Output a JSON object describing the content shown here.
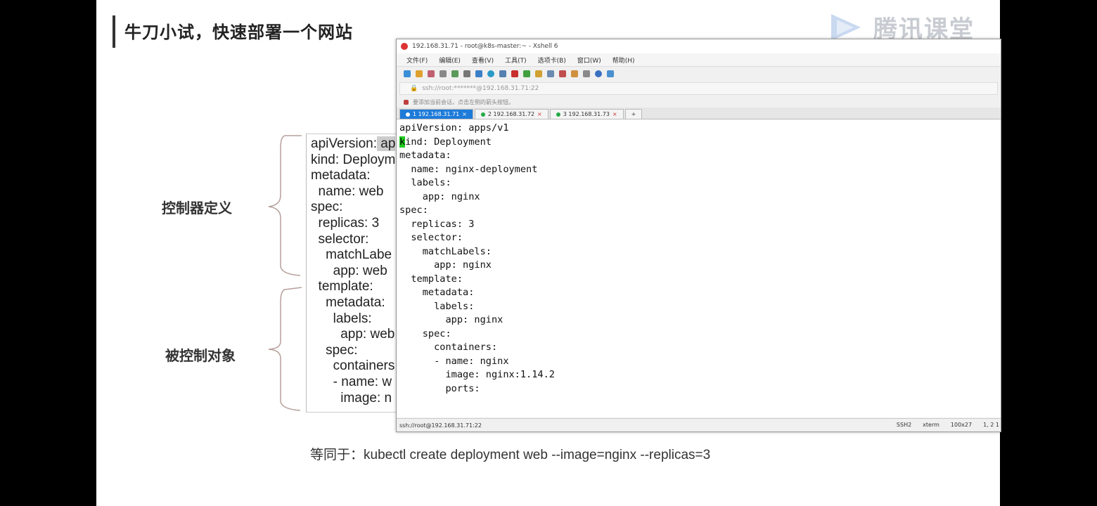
{
  "slide": {
    "title": "牛刀小试，快速部署一个网站",
    "logo_text": "腾讯课堂",
    "label_controller": "控制器定义",
    "label_controlled": "被控制对象",
    "code_lines": [
      "apiVersion: ap",
      "kind: Deploym",
      "metadata:",
      "  name: web",
      "spec:",
      "  replicas: 3",
      "  selector:",
      "    matchLabe",
      "      app: web",
      "  template:",
      "    metadata:",
      "      labels:",
      "        app: web",
      "    spec:",
      "      containers",
      "      - name: w",
      "        image: n"
    ],
    "equivalent": "等同于：kubectl create deployment web --image=nginx --replicas=3"
  },
  "terminal_window": {
    "title": "192.168.31.71 - root@k8s-master:~ - Xshell 6",
    "menu": [
      "文件(F)",
      "编辑(E)",
      "查看(V)",
      "工具(T)",
      "选项卡(B)",
      "窗口(W)",
      "帮助(H)"
    ],
    "address": "ssh://root:*******@192.168.31.71:22",
    "info": "要添加当前会话，点击左侧的箭头按钮。",
    "tabs": [
      {
        "label": "1 192.168.31.71",
        "active": true
      },
      {
        "label": "2 192.168.31.72",
        "active": false
      },
      {
        "label": "3 192.168.31.73",
        "active": false
      }
    ],
    "lines": [
      "apiVersion: apps/v1",
      "kind: Deployment",
      "metadata:",
      "  name: nginx-deployment",
      "  labels:",
      "    app: nginx",
      "spec:",
      "  replicas: 3",
      "  selector:",
      "    matchLabels:",
      "      app: nginx",
      "  template:",
      "    metadata:",
      "      labels:",
      "        app: nginx",
      "    spec:",
      "      containers:",
      "      - name: nginx",
      "        image: nginx:1.14.2",
      "        ports:"
    ],
    "status_left": "ssh://root@192.168.31.71:22",
    "status_right": [
      "SSH2",
      "xterm",
      "100x27",
      "1, 2 1"
    ]
  }
}
